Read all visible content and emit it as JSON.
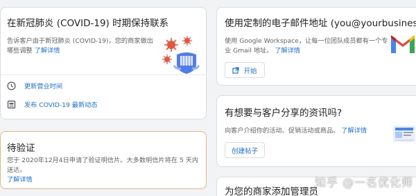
{
  "covid_card": {
    "title": "在新冠肺炎 (COVID-19) 时期保持联系",
    "desc": "告诉客户由于新冠肺炎 (COVID-19)，您的商家做出哪些调整",
    "link": "了解详情",
    "actions": [
      {
        "icon": "clock-icon",
        "label": "更新营业时间"
      },
      {
        "icon": "post-icon",
        "label": "发布 COVID-19 最新动态"
      }
    ]
  },
  "verify_card": {
    "title": "待验证",
    "desc": "您于 2020年12月4日申请了验证明信片。大多数明信片将在 5 天内送达。",
    "link": "了解详情"
  },
  "email_card": {
    "title": "使用定制的电子邮件地址 (you@yourbusiness)",
    "desc": "使用 Google Workspace，让每一位团队成员都有一个专业 Gmail 地址。",
    "link": "了解详情",
    "button": "开始"
  },
  "share_card": {
    "title": "有想要与客户分享的资讯吗?",
    "desc": "向客户介绍你的活动、促销活动或商品。",
    "link": "了解详情",
    "button": "创建帖子"
  },
  "admin_card": {
    "title": "为您的商家添加管理员"
  },
  "watermark": "知乎 @一名优化师",
  "colors": {
    "link": "#1a73e8",
    "virus_red": "#e8553f",
    "shield_blue": "#4f7df0",
    "pending_border": "#f0b37a",
    "gmail_red": "#ea4335",
    "gmail_blue": "#4285f4",
    "gmail_green": "#34a853",
    "gmail_yellow": "#fbbc04"
  }
}
